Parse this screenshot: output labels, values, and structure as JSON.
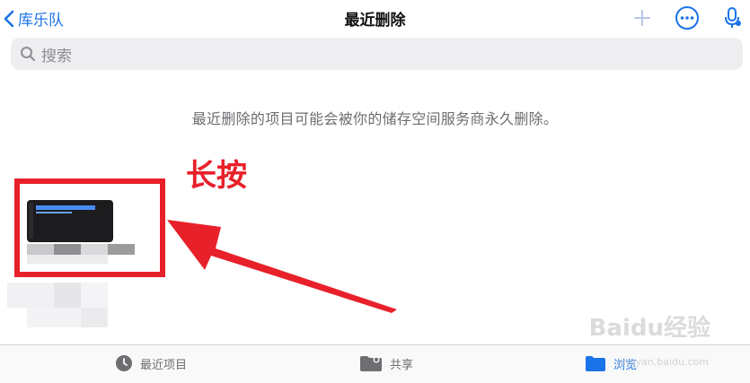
{
  "nav": {
    "back_label": "库乐队",
    "title": "最近删除"
  },
  "search": {
    "placeholder": "搜索"
  },
  "notice": "最近删除的项目可能会被你的储存空间服务商永久删除。",
  "annotation": {
    "label": "长按",
    "color": "#e8202a"
  },
  "tabs": [
    {
      "label": "最近项目",
      "icon": "clock-icon"
    },
    {
      "label": "共享",
      "icon": "shared-folder-icon"
    },
    {
      "label": "浏览",
      "icon": "browse-folder-icon"
    }
  ],
  "watermark": {
    "text": "Baidu经验",
    "sub": "jingyan.baidu.com"
  },
  "colors": {
    "accent": "#1a73e8",
    "annotation": "#e8202a"
  }
}
